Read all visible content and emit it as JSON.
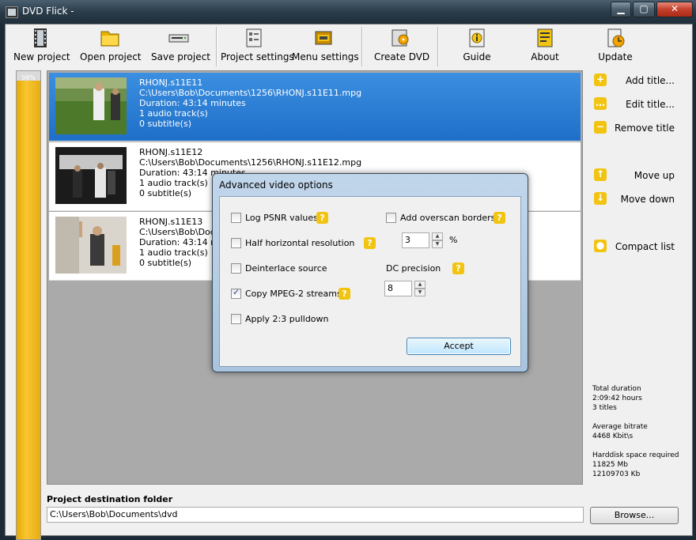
{
  "window": {
    "title": "DVD Flick -",
    "min": "▁",
    "max": "▢",
    "close": "✕"
  },
  "toolbar": [
    {
      "name": "new-project-button",
      "icon": "film-icon",
      "label": "New project"
    },
    {
      "name": "open-project-button",
      "icon": "folder-icon",
      "label": "Open project"
    },
    {
      "name": "save-project-button",
      "icon": "save-drive-icon",
      "label": "Save project"
    },
    {
      "name": "project-settings-button",
      "icon": "settings-icon",
      "label": "Project settings"
    },
    {
      "name": "menu-settings-button",
      "icon": "menu-icon",
      "label": "Menu settings"
    },
    {
      "name": "create-dvd-button",
      "icon": "dvd-burn-icon",
      "label": "Create DVD"
    },
    {
      "name": "guide-button",
      "icon": "guide-icon",
      "label": "Guide"
    },
    {
      "name": "about-button",
      "icon": "about-icon",
      "label": "About"
    },
    {
      "name": "update-button",
      "icon": "update-icon",
      "label": "Update"
    }
  ],
  "progress": {
    "text": "98%",
    "value": 0.98
  },
  "titles": [
    {
      "name": "RHONJ.s11E11",
      "path": "C:\\Users\\Bob\\Documents\\1256\\RHONJ.s11E11.mpg",
      "duration": "Duration: 43:14 minutes",
      "audio": "1 audio track(s)",
      "subs": "0 subtitle(s)"
    },
    {
      "name": "RHONJ.s11E12",
      "path": "C:\\Users\\Bob\\Documents\\1256\\RHONJ.s11E12.mpg",
      "duration": "Duration: 43:14 minutes",
      "audio": "1 audio track(s)",
      "subs": "0 subtitle(s)"
    },
    {
      "name": "RHONJ.s11E13",
      "path": "C:\\Users\\Bob\\Documents\\1256\\RHONJ.s11E13.mpg",
      "duration": "Duration: 43:14 minutes",
      "audio": "1 audio track(s)",
      "subs": "0 subtitle(s)"
    }
  ],
  "side": {
    "add": "Add title...",
    "edit": "Edit title...",
    "remove": "Remove title",
    "up": "Move up",
    "down": "Move down",
    "compact": "Compact list",
    "add_icon": "+",
    "edit_icon": "…",
    "remove_icon": "−",
    "up_icon": "↑",
    "down_icon": "↓",
    "compact_icon": "●"
  },
  "stats": {
    "total_label": "Total duration",
    "total_time": "2:09:42 hours",
    "total_titles": "3 titles",
    "bitrate_label": "Average bitrate",
    "bitrate": "4468 Kbit\\s",
    "space_label": "Harddisk space required",
    "space_mb": "11825 Mb",
    "space_kb": "12109703 Kb"
  },
  "destination": {
    "label": "Project destination folder",
    "value": "C:\\Users\\Bob\\Documents\\dvd",
    "browse": "Browse..."
  },
  "dialog": {
    "title": "Advanced video options",
    "log_psnr": "Log PSNR values",
    "half_res": "Half horizontal resolution",
    "deinterlace": "Deinterlace source",
    "copy_mpeg2": "Copy MPEG-2 streams",
    "pulldown": "Apply 2:3 pulldown",
    "overscan": "Add overscan borders",
    "overscan_value": "3",
    "percent": "%",
    "dc_label": "DC precision",
    "dc_value": "8",
    "help": "?",
    "accept": "Accept",
    "spin_up": "▲",
    "spin_down": "▼"
  }
}
